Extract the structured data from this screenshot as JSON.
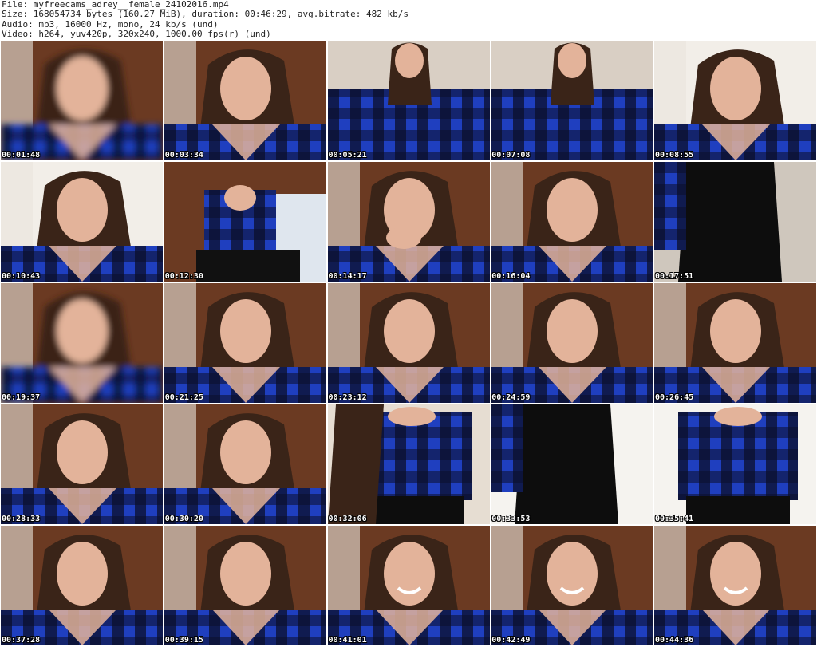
{
  "header": {
    "file_line": "File: myfreecams_adrey__female_24102016.mp4",
    "size_line": "Size: 168054734 bytes (160.27 MiB), duration: 00:46:29, avg.bitrate: 482 kb/s",
    "audio_line": "Audio: mp3, 16000 Hz, mono, 24 kb/s (und)",
    "video_line": "Video: h264, yuv420p, 320x240, 1000.00 fps(r) (und)"
  },
  "colors": {
    "shirt_blue": "#1f3fbf",
    "shirt_dark": "#0b0f2a",
    "skin": "#e3b39a",
    "hair": "#3a2418",
    "wall_light": "#e9e4dc",
    "wood": "#6b3a22"
  },
  "thumbnails": [
    {
      "time": "00:01:48",
      "scene": "closeup-blur"
    },
    {
      "time": "00:03:34",
      "scene": "closeup"
    },
    {
      "time": "00:05:21",
      "scene": "wide-arms"
    },
    {
      "time": "00:07:08",
      "scene": "wide-arms"
    },
    {
      "time": "00:08:55",
      "scene": "closeup-bright"
    },
    {
      "time": "00:10:43",
      "scene": "closeup-bright"
    },
    {
      "time": "00:12:30",
      "scene": "sitting"
    },
    {
      "time": "00:14:17",
      "scene": "closeup-hand"
    },
    {
      "time": "00:16:04",
      "scene": "closeup"
    },
    {
      "time": "00:17:51",
      "scene": "legs"
    },
    {
      "time": "00:19:37",
      "scene": "closeup-blur"
    },
    {
      "time": "00:21:25",
      "scene": "closeup"
    },
    {
      "time": "00:23:12",
      "scene": "closeup"
    },
    {
      "time": "00:24:59",
      "scene": "closeup"
    },
    {
      "time": "00:26:45",
      "scene": "closeup"
    },
    {
      "time": "00:28:33",
      "scene": "closeup"
    },
    {
      "time": "00:30:20",
      "scene": "closeup"
    },
    {
      "time": "00:32:06",
      "scene": "torso-hair"
    },
    {
      "time": "00:33:53",
      "scene": "legs-bright"
    },
    {
      "time": "00:35:41",
      "scene": "torso-bright"
    },
    {
      "time": "00:37:28",
      "scene": "closeup"
    },
    {
      "time": "00:39:15",
      "scene": "closeup"
    },
    {
      "time": "00:41:01",
      "scene": "closeup-smile"
    },
    {
      "time": "00:42:49",
      "scene": "closeup-smile"
    },
    {
      "time": "00:44:36",
      "scene": "closeup-smile"
    }
  ]
}
